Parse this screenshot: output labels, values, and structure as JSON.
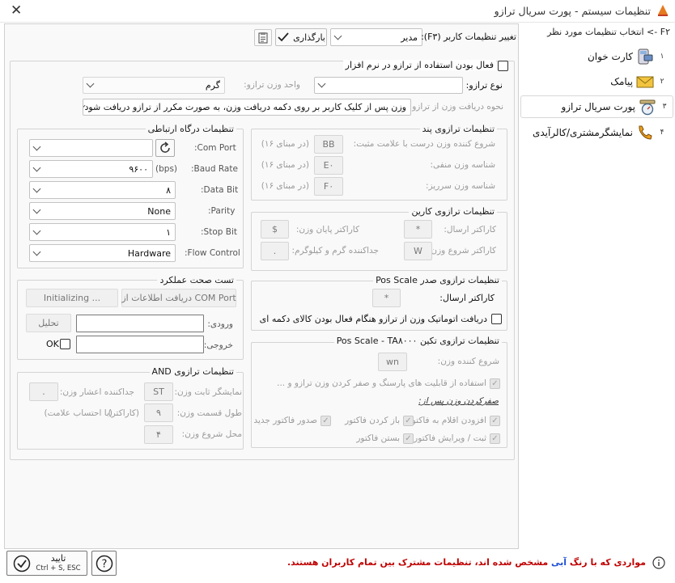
{
  "window": {
    "title": "تنظیمات سیستم - پورت سریال ترازو",
    "close": "✕"
  },
  "sidebar": {
    "header": "F۲ -> انتخاب تنظیمات مورد نظر",
    "items": [
      {
        "num": "۱",
        "label": "کارت خوان"
      },
      {
        "num": "۲",
        "label": "پیامک"
      },
      {
        "num": "۳",
        "label": "پورت سریال ترازو"
      },
      {
        "num": "۴",
        "label": "نمایشگرمشتری/کالرآیدی"
      }
    ]
  },
  "toolbar": {
    "change_user_label": "تغییر تنظیمات کاربر (F۳):",
    "user_value": "مدیر",
    "load_label": "بارگذاری"
  },
  "general": {
    "enable_label": "فعال بودن استفاده از ترازو در نرم افزار",
    "scale_type_label": "نوع ترازو:",
    "scale_type_value": "",
    "unit_label": "واحد وزن ترازو:",
    "unit_value": "گرم",
    "receive_label": "نحوه دریافت وزن از ترازو:",
    "receive_value": "وزن پس از کلیک کاربر بر روی دکمه دریافت وزن، به صورت مکرر از ترازو دریافت شود"
  },
  "pand": {
    "title": "تنظیمات ترازوی پند",
    "rows": [
      {
        "label": "شروع کننده وزن درست با علامت مثبت:",
        "value": "BB",
        "hint": "(در مبنای ۱۶)"
      },
      {
        "label": "شناسه وزن منفی:",
        "value": "E۰",
        "hint": "(در مبنای ۱۶)"
      },
      {
        "label": "شناسه وزن سرریز:",
        "value": "F۰",
        "hint": "(در مبنای ۱۶)"
      }
    ]
  },
  "karin": {
    "title": "تنظیمات ترازوی کارین",
    "send_char_label": "کاراکتر ارسال:",
    "send_char_value": "*",
    "end_char_label": "کاراکتر پایان وزن:",
    "end_char_value": "$",
    "start_char_label": "کاراکتر شروع وزن:",
    "start_char_value": "W",
    "sep_label": "جداکننده گرم و کیلوگرم:",
    "sep_value": "."
  },
  "possadr": {
    "title": "تنظیمات ترازوی صدر Pos Scale",
    "send_char_label": "کاراکتر ارسال:",
    "send_char_value": "*",
    "auto_label": "دریافت اتوماتیک وزن از ترازو هنگام فعال بودن کالای دکمه ای"
  },
  "taktin": {
    "title": "تنظیمات ترازوی تکین Pos Scale - TA۸۰۰۰",
    "start_label": "شروع کننده وزن:",
    "start_value": "wn",
    "tare_label": "استفاده از قابلیت های پارسنگ و صفر کردن وزن ترازو و ...",
    "zero_after_label": "صفرکردن وزن پس از:",
    "opts": [
      "افزودن اقلام به فاکتور",
      "باز کردن فاکتور",
      "صدور فاکتور جدید",
      "ثبت / ویرایش فاکتور",
      "بستن فاکتور"
    ]
  },
  "comm": {
    "title": "تنظیمات درگاه ارتباطی",
    "com_port_label": "Com Port:",
    "com_port_value": "",
    "baud_label": "Baud Rate:",
    "baud_unit": "(bps)",
    "baud_value": "۹۶۰۰",
    "databit_label": "Data Bit:",
    "databit_value": "۸",
    "parity_label": "Parity:",
    "parity_value": "None",
    "stopbit_label": "Stop Bit:",
    "stopbit_value": "۱",
    "flow_label": "Flow Control:",
    "flow_value": "Hardware"
  },
  "test": {
    "title": "تست صحت عملکرد",
    "get_info_label": "دریافت اطلاعات از COM Port",
    "init_label": "Initializing ...",
    "input_label": "ورودی:",
    "analyze_label": "تحلیل",
    "output_label": "خروجی:",
    "ok_label": "OK"
  },
  "and": {
    "title": "تنظیمات ترازوی AND",
    "fixed_label": "نمایشگر ثابت وزن:",
    "fixed_value": "ST",
    "dec_label": "جداکننده اعشار وزن:",
    "dec_value": ".",
    "len_label": "طول قسمت وزن:",
    "len_value": "۹",
    "len_unit": "(کاراکتر)",
    "len_note": "(با احتساب علامت)",
    "pos_label": "محل شروع وزن:",
    "pos_value": "۴"
  },
  "footer": {
    "note_a": "مواردی که با رنگ ",
    "note_blue": "آبی",
    "note_b": " مشخص شده اند، ",
    "note_red": "تنظیمات مشترک بین تمام کاربران هستند.",
    "confirm_label": "تایید",
    "confirm_shortcut": "Ctrl + S, ESC"
  },
  "colors": {
    "accent": "#0078d7",
    "highlight_red": "#c00000",
    "shared_blue": "#1f4fd6"
  }
}
